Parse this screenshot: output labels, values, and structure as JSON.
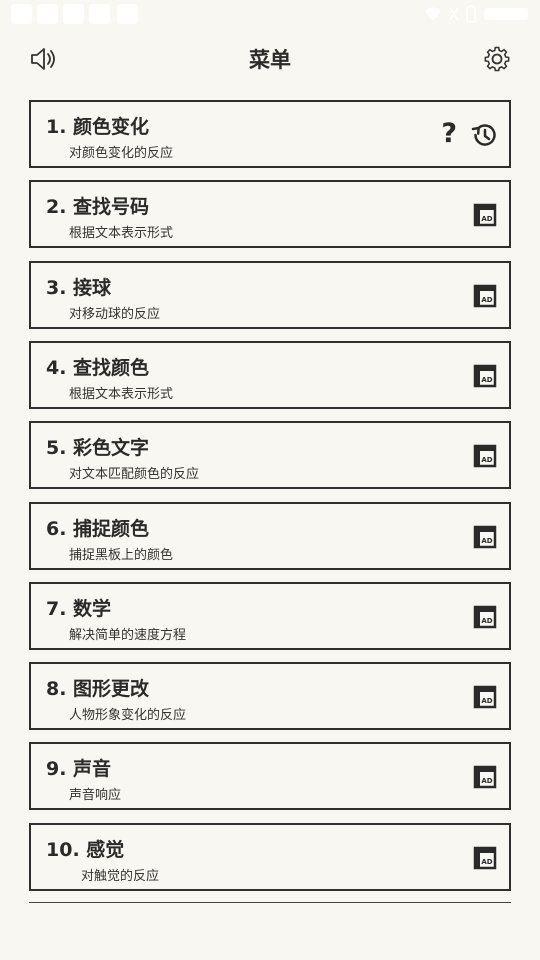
{
  "header": {
    "title": "菜单",
    "sound_icon": "speaker-icon",
    "settings_icon": "gear-icon"
  },
  "menu": {
    "items": [
      {
        "title": "1. 颜色变化",
        "subtitle": "对颜色变化的反应",
        "icons": [
          "question-icon",
          "history-icon"
        ]
      },
      {
        "title": "2. 查找号码",
        "subtitle": "根据文本表示形式",
        "icons": [
          "ad-icon"
        ]
      },
      {
        "title": "3. 接球",
        "subtitle": "对移动球的反应",
        "icons": [
          "ad-icon"
        ]
      },
      {
        "title": "4. 查找颜色",
        "subtitle": "根据文本表示形式",
        "icons": [
          "ad-icon"
        ]
      },
      {
        "title": "5. 彩色文字",
        "subtitle": "对文本匹配颜色的反应",
        "icons": [
          "ad-icon"
        ]
      },
      {
        "title": "6. 捕捉颜色",
        "subtitle": "捕捉黑板上的颜色",
        "icons": [
          "ad-icon"
        ]
      },
      {
        "title": "7. 数学",
        "subtitle": "解决简单的速度方程",
        "icons": [
          "ad-icon"
        ]
      },
      {
        "title": "8. 图形更改",
        "subtitle": "人物形象变化的反应",
        "icons": [
          "ad-icon"
        ]
      },
      {
        "title": "9. 声音",
        "subtitle": "声音响应",
        "icons": [
          "ad-icon"
        ]
      },
      {
        "title": "10. 感觉",
        "subtitle": "对触觉的反应",
        "icons": [
          "ad-icon"
        ]
      }
    ]
  },
  "colors": {
    "background": "#f8f7f2",
    "border": "#2f2f2f",
    "text": "#2a2a2a"
  }
}
